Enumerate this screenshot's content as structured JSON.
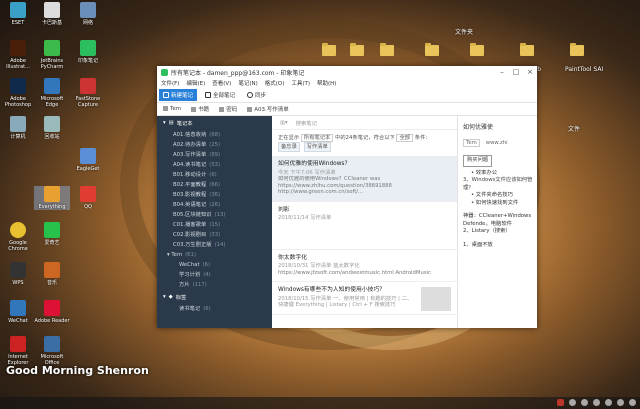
{
  "desktop": {
    "icons": [
      {
        "label": "ESET"
      },
      {
        "label": "卡巴斯基"
      },
      {
        "label": "网络"
      },
      {
        "label": "Adobe Illustrat..."
      },
      {
        "label": "JetBrains PyCharm"
      },
      {
        "label": "印象笔记"
      },
      {
        "label": "Adobe Photoshop"
      },
      {
        "label": "Microsoft Edge"
      },
      {
        "label": "FastStone Capture"
      },
      {
        "label": "计算机"
      },
      {
        "label": "回收站"
      },
      {
        "label": "EagleGet"
      },
      {
        "label": "Everything"
      },
      {
        "label": "QQ"
      },
      {
        "label": "Google Chrome"
      },
      {
        "label": "爱奇艺"
      },
      {
        "label": "WPS"
      },
      {
        "label": "音乐"
      },
      {
        "label": "WeChat"
      },
      {
        "label": "Adobe Reader"
      },
      {
        "label": "Internet Explorer"
      },
      {
        "label": "Microsoft Office"
      },
      {
        "label": "Snipaste"
      },
      {
        "label": "PowerPoint"
      }
    ],
    "right_labels": [
      "文件夹",
      "FlexiHub",
      "PaintTool SAI",
      "文件"
    ],
    "watermark": "Good Morning Shenron"
  },
  "window": {
    "title": "所有笔记本 - damen_ppp@163.com - 印象笔记",
    "menu": [
      "文件(F)",
      "编辑(E)",
      "查看(V)",
      "笔记(N)",
      "格式(O)",
      "工具(T)",
      "帮助(H)"
    ],
    "toolbar": [
      "新建笔记",
      "全部笔记",
      "同步"
    ],
    "shortcuts": [
      "Tem",
      "书籍",
      "密码",
      "A03.写作清单"
    ],
    "sidebar": {
      "header": "笔记本",
      "notebooks": [
        {
          "label": "A01.信息收纳",
          "count": "(68)"
        },
        {
          "label": "A02.待办清单",
          "count": "(25)"
        },
        {
          "label": "A03.写作清单",
          "count": "(89)"
        },
        {
          "label": "A04.读书笔记",
          "count": "(53)"
        },
        {
          "label": "B01.移动设计",
          "count": "(6)"
        },
        {
          "label": "B02.平面教程",
          "count": "(66)"
        },
        {
          "label": "B03.影视教程",
          "count": "(36)"
        },
        {
          "label": "B04.英语笔记",
          "count": "(26)"
        },
        {
          "label": "B05.区块链知识",
          "count": "(13)"
        },
        {
          "label": "C01.播客歌单",
          "count": "(15)"
        },
        {
          "label": "C02.影视剧目",
          "count": "(33)"
        },
        {
          "label": "C03.万生剧正版",
          "count": "(14)"
        }
      ],
      "tem_label": "Tem",
      "tem_count": "(61)",
      "tem_items": [
        {
          "label": "WeChat",
          "count": "(6)"
        },
        {
          "label": "学习计划",
          "count": "(4)"
        },
        {
          "label": "方片",
          "count": "(117)"
        }
      ],
      "tags_label": "标签",
      "tags_sub": "读书笔记",
      "tags_count": "(6)"
    },
    "notelist": {
      "search_placeholder": "搜索笔记",
      "filter_text": "正在显示",
      "filter_select": "所有笔记本",
      "filter_count": "中的24条笔记，符合以下",
      "filter_all": "全部",
      "filter_cond": "条件：",
      "chips": [
        "备忘录",
        "写作清单"
      ],
      "notes": [
        {
          "title": "如何优雅的使用Windows？",
          "meta": "今天 下午7:06  写作清单",
          "snippet": "如何优雅的使用Windows？CCleaner was https://www.zhihu.com/question/38691888 http://www.green.com.cn/soft/..."
        },
        {
          "title": "刘影",
          "meta": "2018/11/14  写作清单",
          "snippet": ""
        },
        {
          "title": "你太数字化",
          "meta": "2018/10/31  写作清单  蓝太数字化",
          "snippet": "https://www.jfzsoft.com/andwestmusic.html AndroidMusic"
        },
        {
          "title": "Windows有哪些不为人知的使用小技巧？",
          "meta": "2018/10/15  写作清单  一、使用常用 | 有趣的技巧 | 二、快捷键 Everything | Listary | Ctrl + F 搜索技巧",
          "snippet": ""
        }
      ]
    },
    "editor": {
      "title": "如何优雅使",
      "notebook_tag": "Tem",
      "url_stub": "www.zhi",
      "body_lines": [
        "购买问题",
        "• 效率办公",
        "3、Windows文件应该如何管理？",
        "• 文件夹命名技巧",
        "• 如何快速找到文件",
        "神器：CCleaner+Windows Defende，电脑软件",
        "2、Listary（搜索）",
        "1、桌面不放"
      ]
    }
  },
  "behind_window": {
    "label": "文件夹"
  }
}
